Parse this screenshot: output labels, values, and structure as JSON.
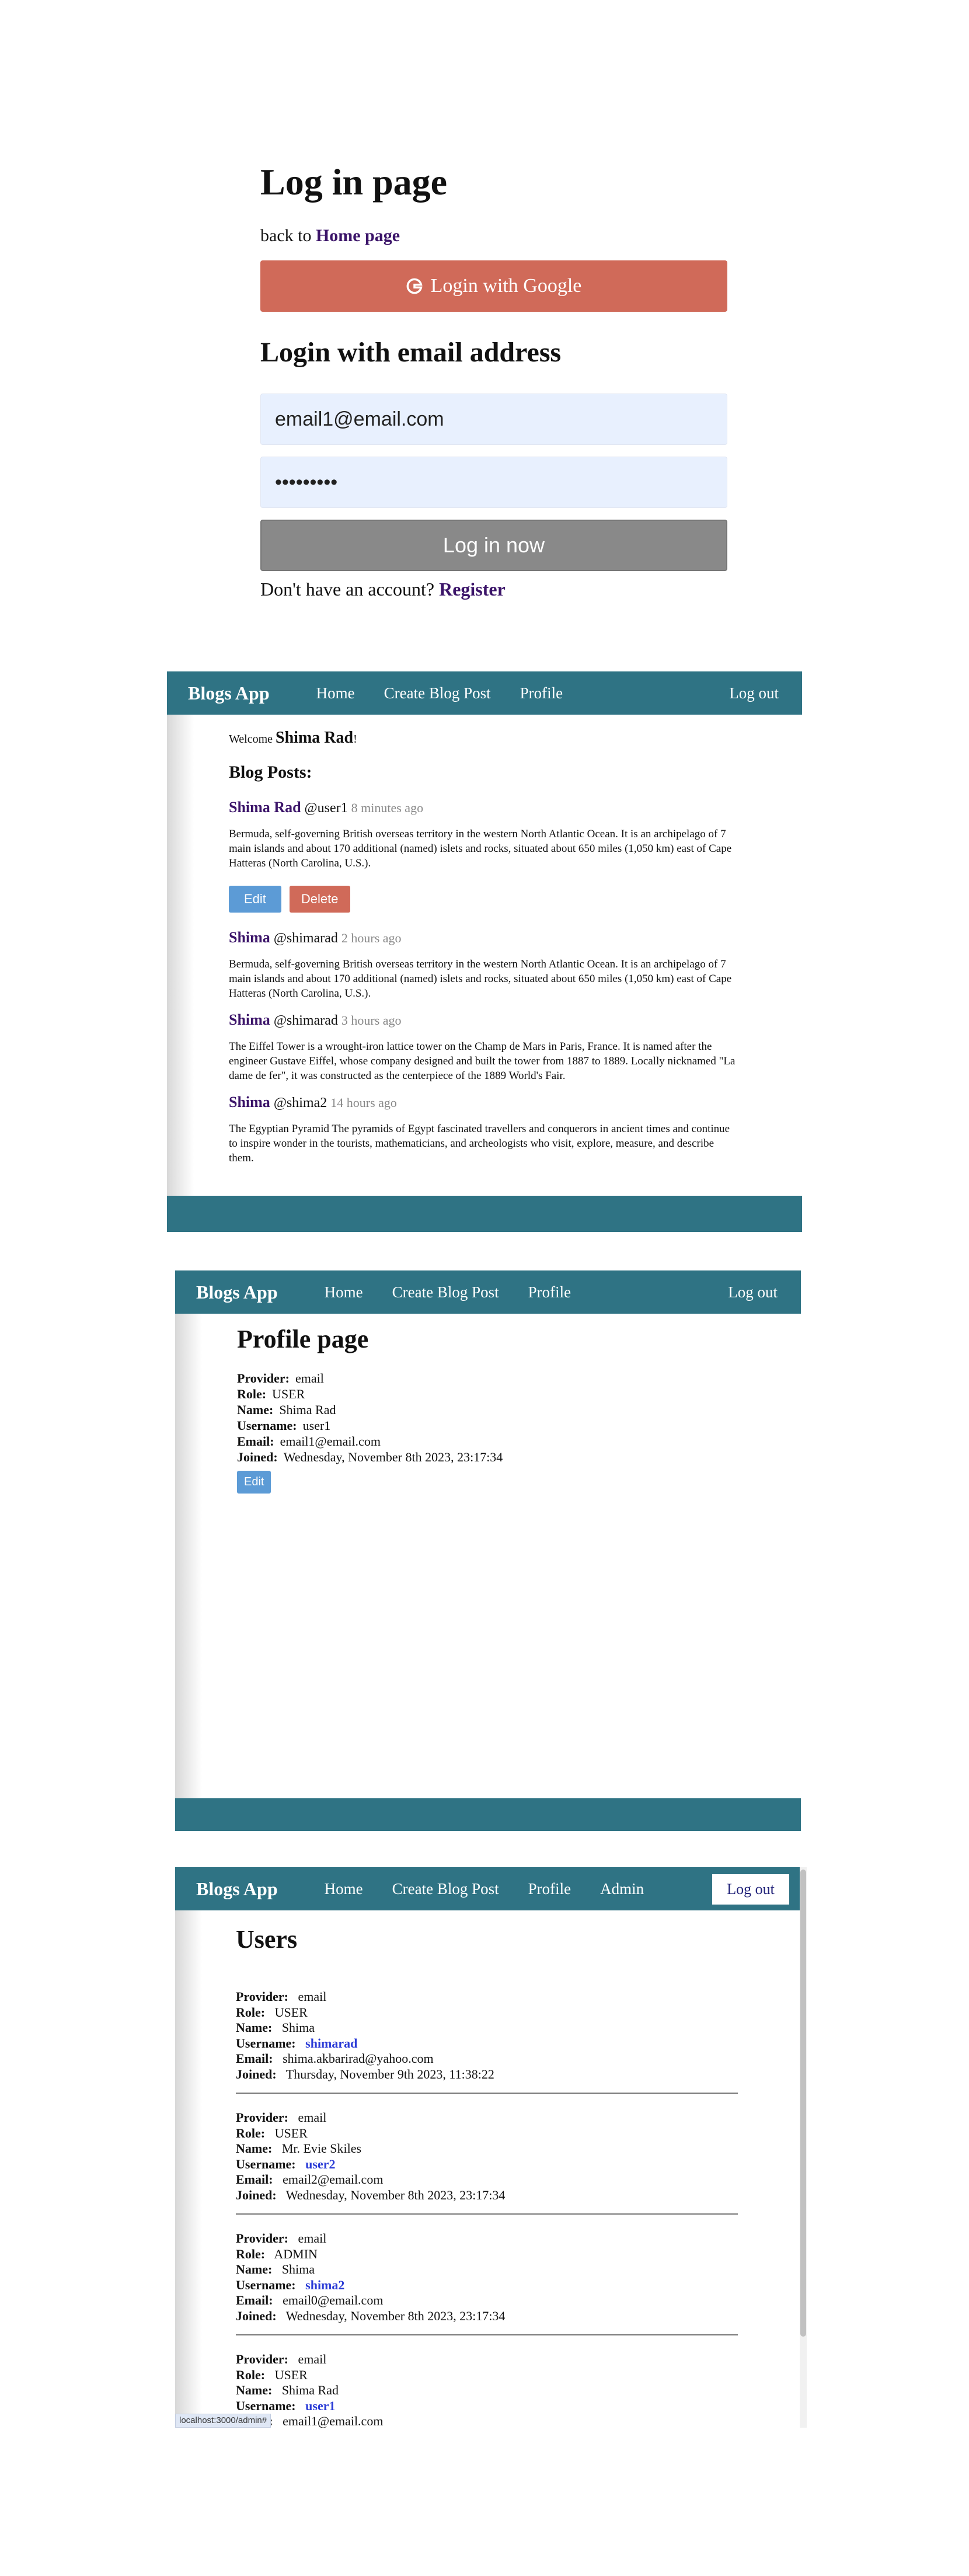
{
  "login": {
    "title": "Log in page",
    "back_prefix": "back to ",
    "back_link": "Home page",
    "google_label": "Login with Google",
    "email_heading": "Login with email address",
    "email_value": "email1@email.com",
    "password_value": "•••••••••",
    "submit_label": "Log in now",
    "register_prefix": "Don't have an account? ",
    "register_link": "Register"
  },
  "nav": {
    "brand": "Blogs App",
    "home": "Home",
    "create": "Create Blog Post",
    "profile": "Profile",
    "admin": "Admin",
    "logout": "Log out"
  },
  "blog": {
    "welcome_prefix": "Welcome ",
    "welcome_name": "Shima Rad",
    "welcome_suffix": "!",
    "heading": "Blog Posts:",
    "edit_label": "Edit",
    "delete_label": "Delete",
    "posts": [
      {
        "author": "Shima Rad",
        "handle": "@user1",
        "time": "8 minutes ago",
        "body": "Bermuda, self-governing British overseas territory in the western North Atlantic Ocean. It is an archipelago of 7 main islands and about 170 additional (named) islets and rocks, situated about 650 miles (1,050 km) east of Cape Hatteras (North Carolina, U.S.)."
      },
      {
        "author": "Shima",
        "handle": "@shimarad",
        "time": "2 hours ago",
        "body": "Bermuda, self-governing British overseas territory in the western North Atlantic Ocean. It is an archipelago of 7 main islands and about 170 additional (named) islets and rocks, situated about 650 miles (1,050 km) east of Cape Hatteras (North Carolina, U.S.)."
      },
      {
        "author": "Shima",
        "handle": "@shimarad",
        "time": "3 hours ago",
        "body": "The Eiffel Tower is a wrought-iron lattice tower on the Champ de Mars in Paris, France. It is named after the engineer Gustave Eiffel, whose company designed and built the tower from 1887 to 1889. Locally nicknamed \"La dame de fer\", it was constructed as the centerpiece of the 1889 World's Fair."
      },
      {
        "author": "Shima",
        "handle": "@shima2",
        "time": "14 hours ago",
        "body": "The Egyptian Pyramid The pyramids of Egypt fascinated travellers and conquerors in ancient times and continue to inspire wonder in the tourists, mathematicians, and archeologists who visit, explore, measure, and describe them."
      }
    ]
  },
  "profile": {
    "title": "Profile page",
    "labels": {
      "provider": "Provider:",
      "role": "Role:",
      "name": "Name:",
      "username": "Username:",
      "email": "Email:",
      "joined": "Joined:"
    },
    "provider": "email",
    "role": "USER",
    "name": "Shima Rad",
    "username": "user1",
    "email": "email1@email.com",
    "joined": "Wednesday, November 8th 2023, 23:17:34",
    "edit_label": "Edit"
  },
  "users": {
    "title": "Users",
    "list": [
      {
        "provider": "email",
        "role": "USER",
        "name": "Shima",
        "username": "shimarad",
        "email": "shima.akbarirad@yahoo.com",
        "joined": "Thursday, November 9th 2023, 11:38:22"
      },
      {
        "provider": "email",
        "role": "USER",
        "name": "Mr. Evie Skiles",
        "username": "user2",
        "email": "email2@email.com",
        "joined": "Wednesday, November 8th 2023, 23:17:34"
      },
      {
        "provider": "email",
        "role": "ADMIN",
        "name": "Shima",
        "username": "shima2",
        "email": "email0@email.com",
        "joined": "Wednesday, November 8th 2023, 23:17:34"
      },
      {
        "provider": "email",
        "role": "USER",
        "name": "Shima Rad",
        "username": "user1",
        "email": "email1@email.com",
        "joined": ""
      }
    ],
    "status_url": "localhost:3000/admin#"
  }
}
